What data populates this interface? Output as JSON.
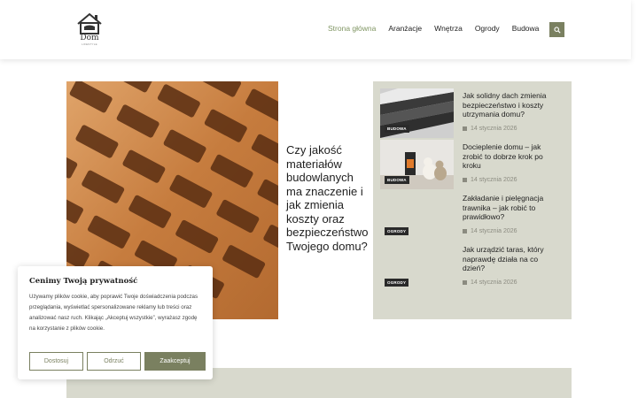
{
  "logo": {
    "text": "Dom",
    "tagline": "LIFESTYLE"
  },
  "nav": {
    "items": [
      "Strona główna",
      "Aranżacje",
      "Wnętrza",
      "Ogrody",
      "Budowa"
    ],
    "active_color": "#7f9562"
  },
  "search": {
    "icon": "search-icon"
  },
  "hero": {
    "title": "Czy jakość materiałów budowlanych ma znaczenie i jak zmienia koszty oraz bezpieczeństwo Twojego domu?"
  },
  "sidebar": {
    "articles": [
      {
        "badge": "BUDOWA",
        "title": "Jak solidny dach zmienia bezpieczeństwo i koszty utrzymania domu?",
        "date": "14 stycznia 2026",
        "thumb": "roof"
      },
      {
        "badge": "BUDOWA",
        "title": "Docieplenie domu – jak zrobić to dobrze krok po kroku",
        "date": "14 stycznia 2026",
        "thumb": "dogs-fireplace"
      },
      {
        "badge": "OGRODY",
        "title": "Zakładanie i pielęgnacja trawnika – jak robić to prawidłowo?",
        "date": "14 stycznia 2026",
        "thumb": "none"
      },
      {
        "badge": "OGRODY",
        "title": "Jak urządzić taras, który naprawdę działa na co dzień?",
        "date": "14 stycznia 2026",
        "thumb": "none"
      }
    ]
  },
  "cookie": {
    "title": "Cenimy Twoją prywatność",
    "text": "Używamy plików cookie, aby poprawić Twoje doświadczenia podczas przeglądania, wyświetlać spersonalizowane reklamy lub treści oraz analizować nasz ruch. Klikając „Akceptuj wszystkie”, wyrażasz zgodę na korzystanie z plików cookie.",
    "buttons": {
      "customize": "Dostosuj",
      "reject": "Odrzuć",
      "accept": "Zaakceptuj"
    }
  },
  "colors": {
    "accent": "#7a8060",
    "panel": "#d8d9cd"
  }
}
